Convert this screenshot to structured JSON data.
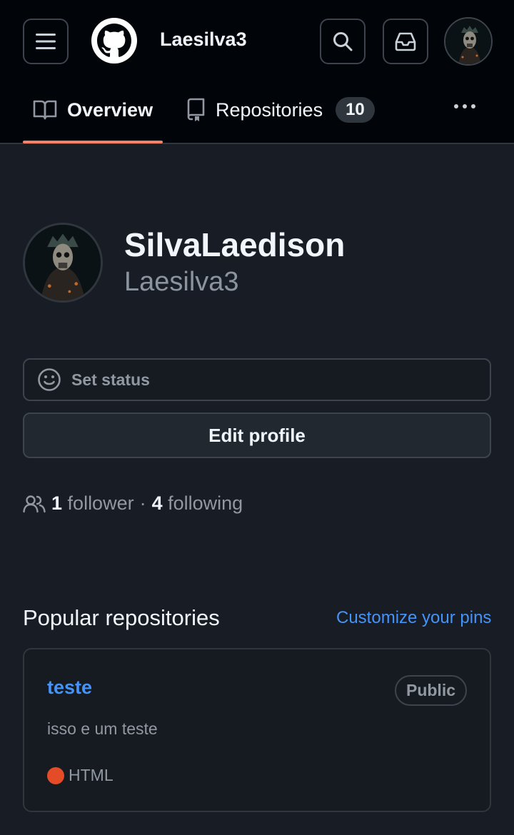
{
  "header": {
    "username": "Laesilva3",
    "icons": {
      "menu": "hamburger-icon",
      "logo": "github-mark-icon",
      "search": "search-icon",
      "inbox": "inbox-icon"
    }
  },
  "tabs": [
    {
      "label": "Overview",
      "icon": "book-icon",
      "selected": true
    },
    {
      "label": "Repositories",
      "icon": "repo-icon",
      "count": "10",
      "selected": false
    }
  ],
  "profile": {
    "display_name": "SilvaLaedison",
    "login": "Laesilva3",
    "status_placeholder": "Set status",
    "edit_label": "Edit profile",
    "followers_count": "1",
    "followers_label": "follower",
    "separator": "·",
    "following_count": "4",
    "following_label": "following"
  },
  "popular": {
    "title": "Popular repositories",
    "customize_label": "Customize your pins",
    "repos": [
      {
        "name": "teste",
        "visibility": "Public",
        "description": "isso e um teste",
        "language": "HTML",
        "language_color": "#e34c26"
      }
    ]
  },
  "colors": {
    "accent_link": "#4493f8",
    "tab_underline": "#f78166",
    "header_bg": "#010409",
    "page_bg": "#181c24"
  }
}
